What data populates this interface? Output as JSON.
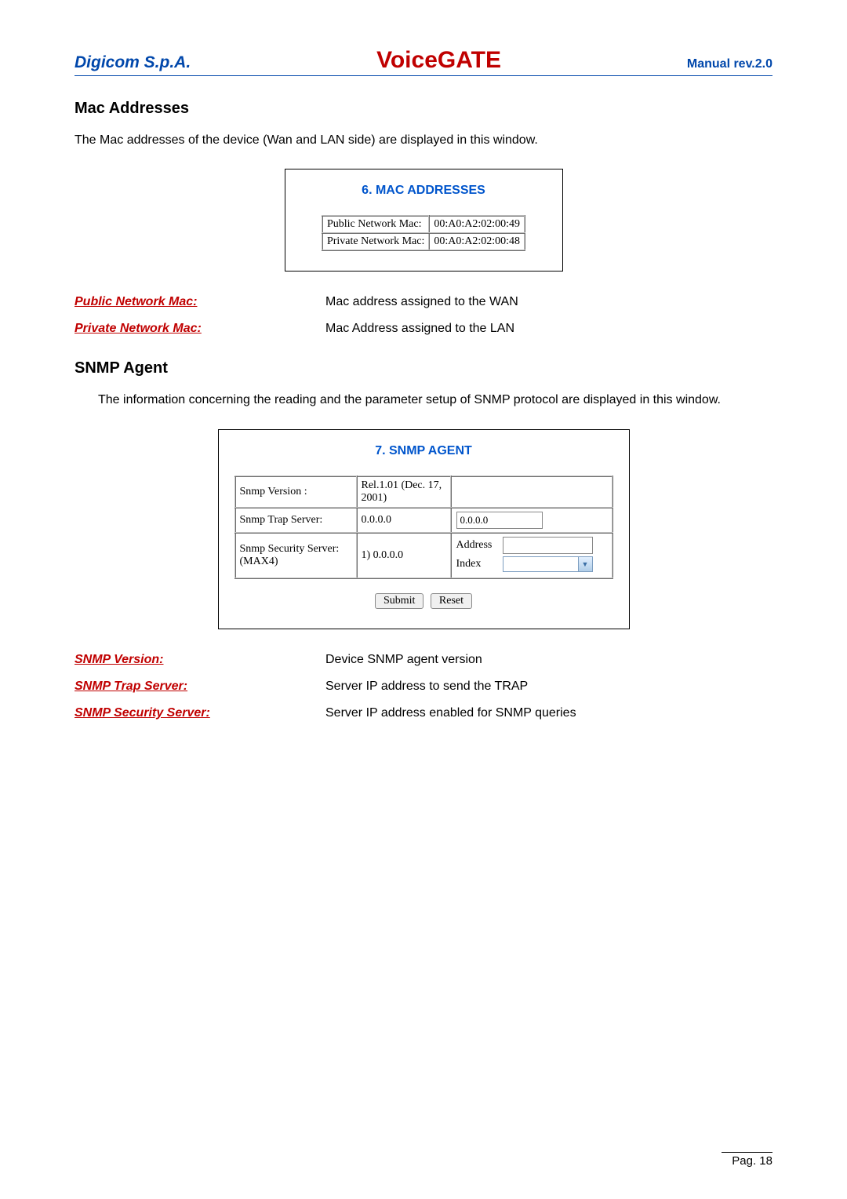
{
  "header": {
    "left": "Digicom S.p.A.",
    "center": "VoiceGATE",
    "right": "Manual rev.2.0"
  },
  "mac_section": {
    "title": "Mac Addresses",
    "description": "The Mac addresses of the device (Wan and LAN side) are displayed in this window.",
    "panel_title": "6. MAC ADDRESSES",
    "rows": [
      {
        "label": "Public Network Mac:",
        "value": "00:A0:A2:02:00:49"
      },
      {
        "label": "Private Network Mac:",
        "value": "00:A0:A2:02:00:48"
      }
    ],
    "defs": [
      {
        "term": "Public Network Mac:",
        "desc": "Mac address assigned to the WAN"
      },
      {
        "term": "Private Network Mac:",
        "desc": "Mac Address assigned to the LAN"
      }
    ]
  },
  "snmp_section": {
    "title": "SNMP Agent",
    "description": "The information concerning the reading and the parameter setup of SNMP protocol are displayed in this window.",
    "panel_title": "7. SNMP AGENT",
    "rows": {
      "version": {
        "label": "Snmp Version :",
        "value": "Rel.1.01 (Dec. 17, 2001)"
      },
      "trap": {
        "label": "Snmp Trap Server:",
        "value": "0.0.0.0",
        "input": "0.0.0.0"
      },
      "security": {
        "label": "Snmp Security Server: (MAX4)",
        "value": "1) 0.0.0.0",
        "address_label": "Address",
        "index_label": "Index"
      }
    },
    "buttons": {
      "submit": "Submit",
      "reset": "Reset"
    },
    "defs": [
      {
        "term": "SNMP Version:",
        "desc": "Device SNMP agent version"
      },
      {
        "term": "SNMP Trap Server:",
        "desc": "Server IP address to send the TRAP"
      },
      {
        "term": "SNMP Security Server:",
        "desc": "Server IP address enabled for SNMP queries"
      }
    ]
  },
  "footer": "Pag. 18"
}
